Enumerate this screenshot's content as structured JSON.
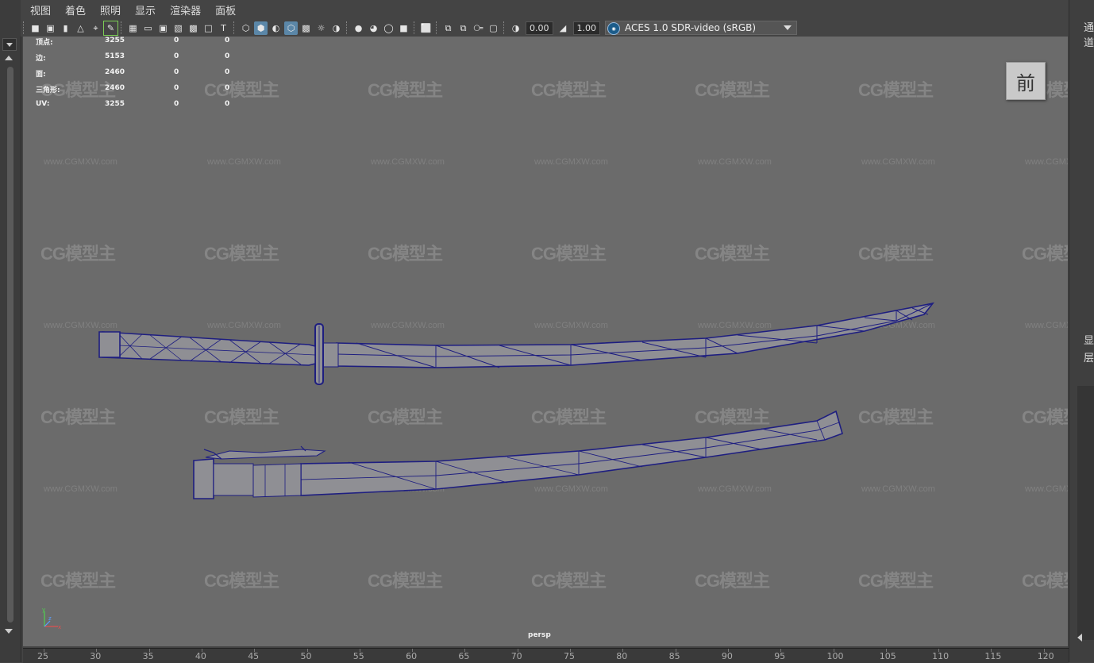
{
  "menubar": {
    "items": [
      "视图",
      "着色",
      "照明",
      "显示",
      "渲染器",
      "面板"
    ]
  },
  "toolbar": {
    "exposure_value": "0.00",
    "gamma_value": "1.00",
    "color_space_label": "ACES 1.0 SDR-video (sRGB)",
    "icons": [
      "camera-select-icon",
      "camera-attributes-icon",
      "bookmark-icon",
      "image-plane-icon",
      "2d-pan-zoom-icon",
      "grease-pencil-icon",
      "grid-icon",
      "film-gate-icon",
      "resolution-gate-icon",
      "gate-mask-icon",
      "field-chart-icon",
      "safe-action-icon",
      "safe-title-icon",
      "wireframe-icon",
      "smooth-shade-icon",
      "default-material-icon",
      "wireframe-on-shaded-icon",
      "textured-icon",
      "use-all-lights-icon",
      "shadows-icon",
      "screen-space-ao-icon",
      "motion-blur-icon",
      "multisample-aa-icon",
      "depth-of-field-icon",
      "isolate-select-icon",
      "xray-icon",
      "xray-active-icon",
      "xray-joints-icon",
      "backface-cull-icon",
      "exposure-icon",
      "gamma-icon",
      "color-management-icon"
    ]
  },
  "hud": {
    "rows": [
      {
        "label": "顶点:",
        "v1": "3255",
        "v2": "0",
        "v3": "0"
      },
      {
        "label": "边:",
        "v1": "5153",
        "v2": "0",
        "v3": "0"
      },
      {
        "label": "面:",
        "v1": "2460",
        "v2": "0",
        "v3": "0"
      },
      {
        "label": "三角形:",
        "v1": "2460",
        "v2": "0",
        "v3": "0"
      },
      {
        "label": "UV:",
        "v1": "3255",
        "v2": "0",
        "v3": "0"
      }
    ]
  },
  "view_cube_label": "前",
  "camera_label": "persp",
  "axis_labels": {
    "y": "y",
    "z": "z",
    "x": "x"
  },
  "watermark": {
    "logo_text": "CG模型主",
    "url_text": "www.CGMXW.com"
  },
  "right_panel": {
    "top_text": "通道",
    "display_tab": "显",
    "layer_tab": "层"
  },
  "ruler": {
    "labels": [
      "25",
      "30",
      "35",
      "40",
      "45",
      "50",
      "55",
      "60",
      "65",
      "70",
      "75",
      "80",
      "85",
      "90",
      "95",
      "100",
      "105",
      "110",
      "115",
      "120"
    ]
  },
  "colors": {
    "viewport_bg": "#6b6b6b",
    "wireframe": "#1e1e80",
    "mesh_fill": "#8f8f94",
    "active_icon": "#5b87a8"
  }
}
